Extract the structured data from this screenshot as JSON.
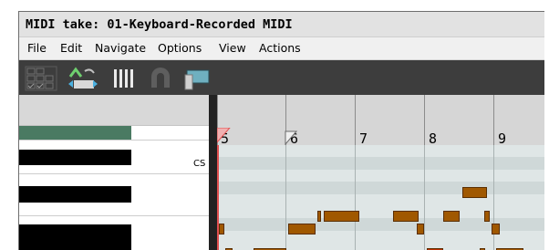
{
  "window": {
    "title": "MIDI take: 01-Keyboard-Recorded MIDI"
  },
  "menu": {
    "items": [
      "File",
      "Edit",
      "Navigate",
      "Options",
      "View",
      "Actions"
    ]
  },
  "toolbar": {
    "buttons": [
      "grid-checks-icon",
      "velocity-lanes-icon",
      "bars-icon",
      "magnet-icon",
      "monitor-icon"
    ]
  },
  "piano": {
    "cs_label": "CS"
  },
  "ruler": {
    "measures": [
      "5",
      "6",
      "7",
      "8",
      "9"
    ]
  },
  "colors": {
    "toolbar_bg": "#3d3d3d",
    "note": "#a05800",
    "note_selected": "#c03000",
    "notes_bg": "#dfe6e6",
    "playhead": "#e05050",
    "keyboard_highlight": "#4a7a62"
  }
}
